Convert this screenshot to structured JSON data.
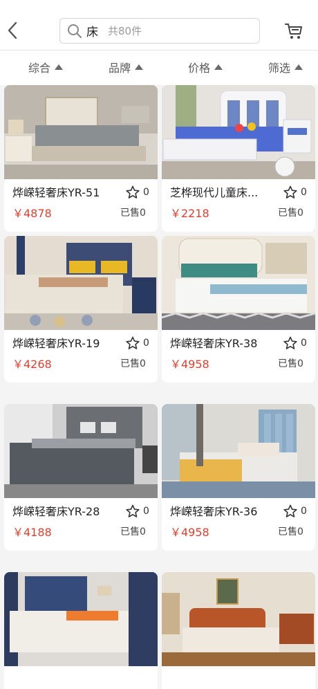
{
  "header": {
    "back_icon": "chevron-left-icon",
    "search_keyword": "床",
    "search_total": "共80件",
    "search_icon": "search-icon",
    "cart_icon": "cart-icon"
  },
  "sortbar": {
    "items": [
      {
        "label": "综合"
      },
      {
        "label": "品牌"
      },
      {
        "label": "价格"
      },
      {
        "label": "筛选"
      }
    ]
  },
  "colors": {
    "price": "#e0402f",
    "background": "#f4f4f4"
  },
  "products": [
    {
      "name": "烨嵘轻奢床YR-51",
      "price": "￥4878",
      "fav": "0",
      "sold": "已售0"
    },
    {
      "name": "芝桦现代儿童床...",
      "price": "￥2218",
      "fav": "0",
      "sold": "已售0"
    },
    {
      "name": "烨嵘轻奢床YR-19",
      "price": "￥4268",
      "fav": "0",
      "sold": "已售0"
    },
    {
      "name": "烨嵘轻奢床YR-38",
      "price": "￥4958",
      "fav": "0",
      "sold": "已售0"
    },
    {
      "name": "烨嵘轻奢床YR-28",
      "price": "￥4188",
      "fav": "0",
      "sold": "已售0"
    },
    {
      "name": "烨嵘轻奢床YR-36",
      "price": "￥4958",
      "fav": "0",
      "sold": "已售0"
    },
    {
      "name": "",
      "price": "",
      "fav": "",
      "sold": ""
    },
    {
      "name": "",
      "price": "",
      "fav": "",
      "sold": ""
    }
  ]
}
